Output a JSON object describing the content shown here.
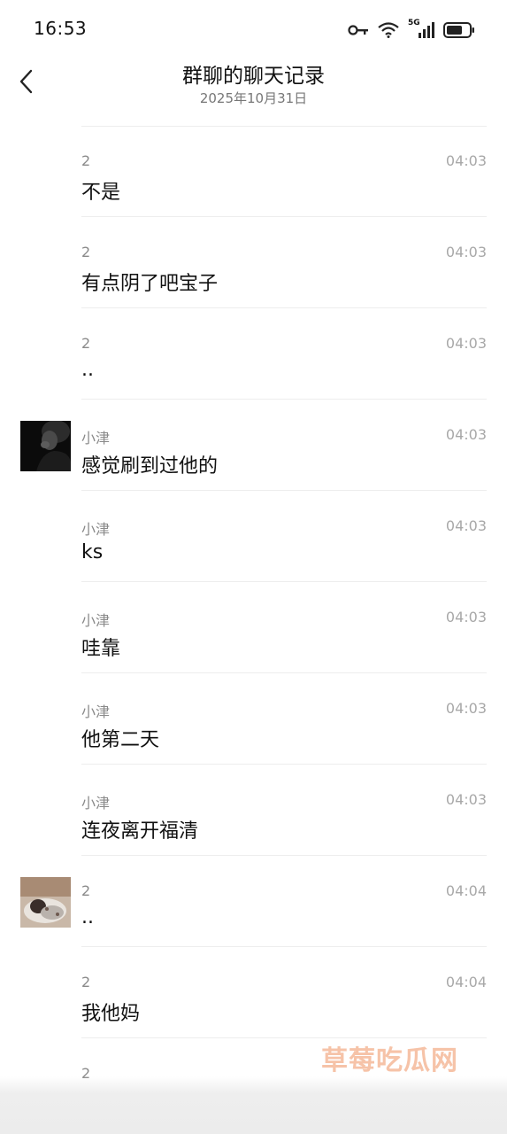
{
  "status_bar": {
    "time": "16:53",
    "network": "5G",
    "icons": [
      "key-icon",
      "wifi-icon",
      "signal-icon",
      "battery-icon"
    ]
  },
  "header": {
    "title": "群聊的聊天记录",
    "subtitle": "2025年10月31日",
    "back_icon": "chevron-left-icon"
  },
  "messages": [
    {
      "sender": "2",
      "time": "04:03",
      "text": "不是",
      "avatar": ""
    },
    {
      "sender": "2",
      "time": "04:03",
      "text": "有点阴了吧宝子",
      "avatar": ""
    },
    {
      "sender": "2",
      "time": "04:03",
      "text": "..",
      "avatar": ""
    },
    {
      "sender": "小津",
      "time": "04:03",
      "text": "感觉刷到过他的",
      "avatar": "dark-portrait-avatar"
    },
    {
      "sender": "小津",
      "time": "04:03",
      "text": "ks",
      "avatar": ""
    },
    {
      "sender": "小津",
      "time": "04:03",
      "text": "哇靠",
      "avatar": ""
    },
    {
      "sender": "小津",
      "time": "04:03",
      "text": "他第二天",
      "avatar": ""
    },
    {
      "sender": "小津",
      "time": "04:03",
      "text": "连夜离开福清",
      "avatar": ""
    },
    {
      "sender": "2",
      "time": "04:04",
      "text": "..",
      "avatar": "sleeping-person-avatar"
    },
    {
      "sender": "2",
      "time": "04:04",
      "text": "我他妈",
      "avatar": ""
    },
    {
      "sender": "2",
      "time": "",
      "text": "",
      "avatar": ""
    }
  ],
  "watermark": "草莓吃瓜网",
  "colors": {
    "background": "#ffffff",
    "text": "#111111",
    "meta": "#8a8a8a",
    "divider": "#ededed",
    "watermark": "#f6c3a8"
  }
}
